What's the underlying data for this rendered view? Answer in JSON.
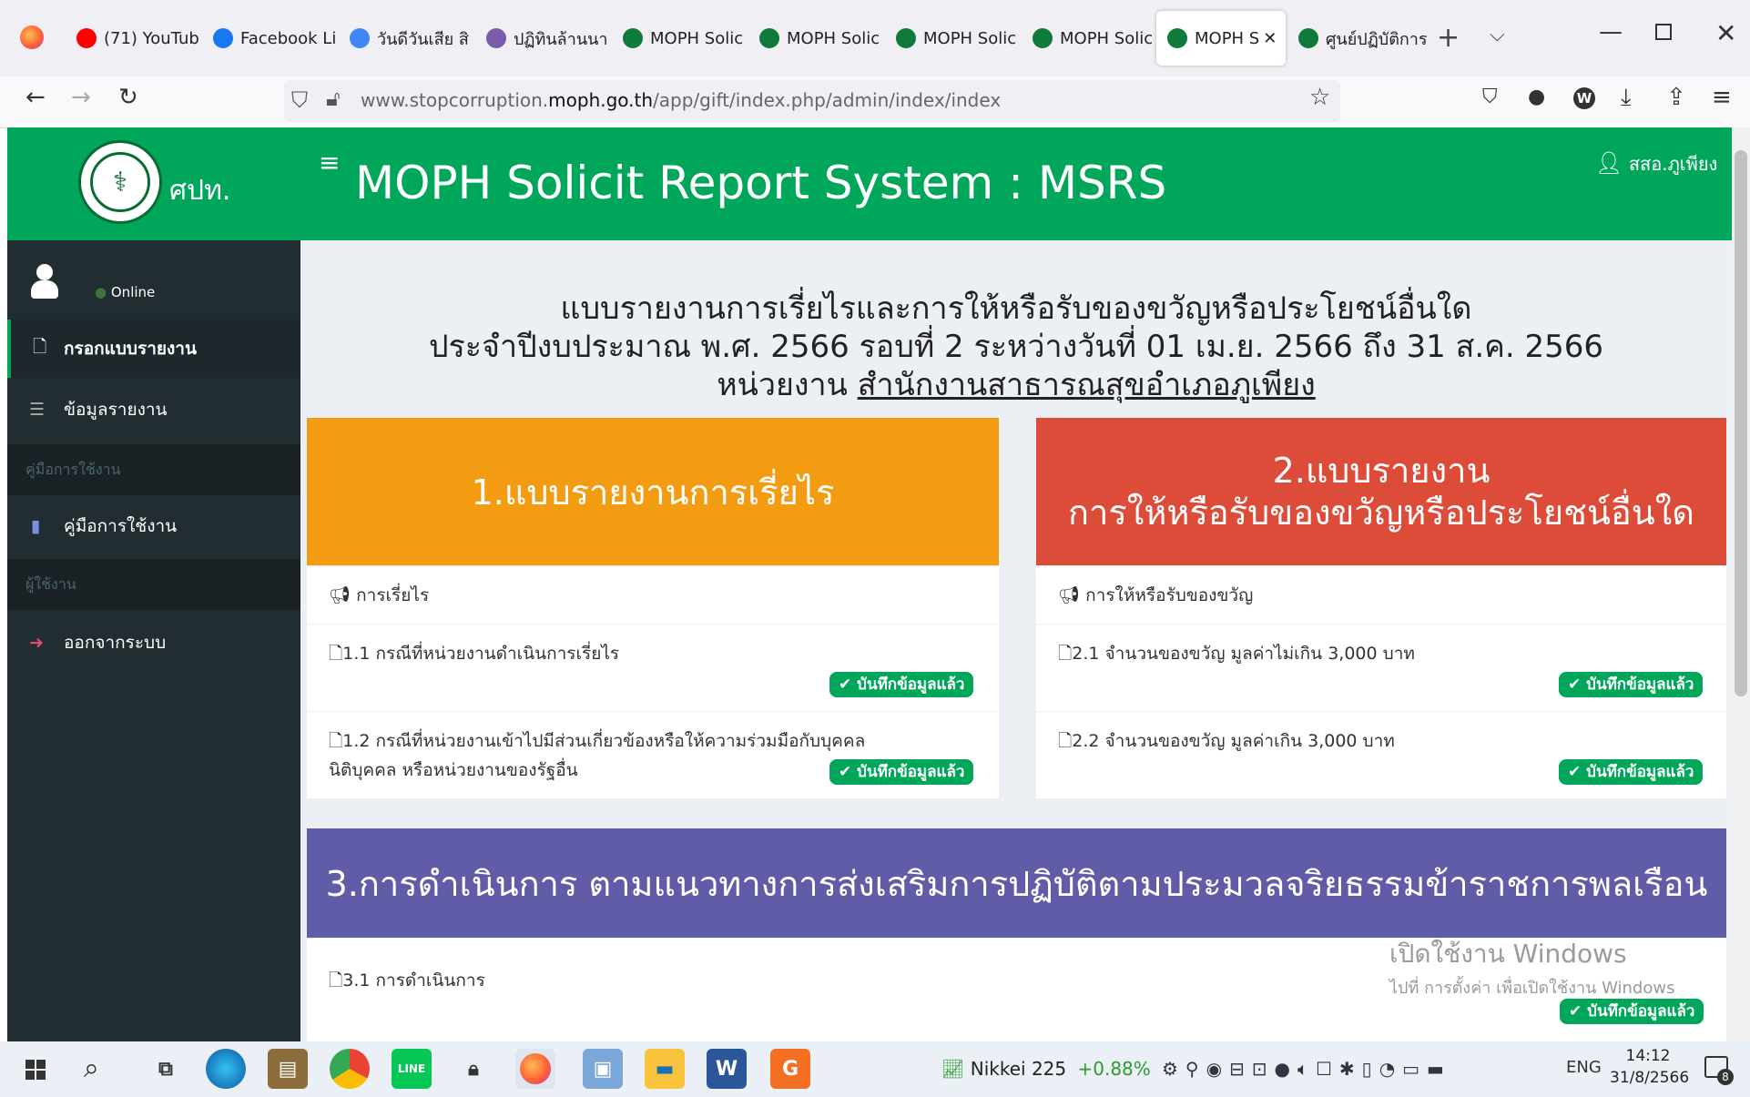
{
  "browser": {
    "tabs": [
      {
        "label": "(71) YouTub",
        "icon": "youtube-icon",
        "color": "#ff0000"
      },
      {
        "label": "Facebook Li",
        "icon": "facebook-icon",
        "color": "#1877f2"
      },
      {
        "label": "วันดีวันเสีย สิ",
        "icon": "google-icon",
        "color": "#4285f4"
      },
      {
        "label": "ปฏิทินล้านนา",
        "icon": "calendar-site-icon",
        "color": "#7a5ca8"
      },
      {
        "label": "MOPH Solic",
        "icon": "moph-icon",
        "color": "#0f7a3a"
      },
      {
        "label": "MOPH Solic",
        "icon": "moph-icon",
        "color": "#0f7a3a"
      },
      {
        "label": "MOPH Solic",
        "icon": "moph-icon",
        "color": "#0f7a3a"
      },
      {
        "label": "MOPH Solic",
        "icon": "moph-icon",
        "color": "#0f7a3a"
      },
      {
        "label": "MOPH S",
        "icon": "moph-icon",
        "color": "#0f7a3a",
        "active": true
      },
      {
        "label": "ศูนย์ปฏิบัติการ",
        "icon": "moph-icon",
        "color": "#0f7a3a"
      }
    ],
    "url_plain": "www.stopcorruption.",
    "url_domain": "moph.go.th",
    "url_path": "/app/gift/index.php/admin/index/index"
  },
  "app": {
    "brand": "ศปท.",
    "title": "MOPH Solicit Report System : MSRS",
    "user": "สสอ.ภูเพียง",
    "status": "Online"
  },
  "sidebar": {
    "items": [
      {
        "label": "กรอกแบบรายงาน",
        "icon": "document-icon"
      },
      {
        "label": "ข้อมูลรายงาน",
        "icon": "list-icon"
      }
    ],
    "header_manual": "คู่มือการใช้งาน",
    "manual_item": "คู่มือการใช้งาน",
    "header_user": "ผู้ใช้งาน",
    "logout": "ออกจากระบบ"
  },
  "report": {
    "title_line1": "แบบรายงานการเรี่ยไรและการให้หรือรับของขวัญหรือประโยชน์อื่นใด",
    "title_line2": "ประจำปีงบประมาณ พ.ศ. 2566 รอบที่ 2 ระหว่างวันที่ 01 เม.ย. 2566 ถึง 31 ส.ค. 2566",
    "unit_label": "หน่วยงาน",
    "unit_name": "สำนักงานสาธารณสุขอำเภอภูเพียง"
  },
  "box1": {
    "title": "1.แบบรายงานการเรี่ยไร",
    "section": "การเรี่ยไร",
    "row1": "1.1 กรณีที่หน่วยงานดำเนินการเรี่ยไร",
    "row2a": "1.2 กรณีที่หน่วยงานเข้าไปมีส่วนเกี่ยวข้องหรือให้ความร่วมมือกับบุคคล",
    "row2b": "นิติบุคคล หรือหน่วยงานของรัฐอื่น",
    "color": "#f39c12"
  },
  "box2": {
    "title_line1": "2.แบบรายงาน",
    "title_line2": "การให้หรือรับของขวัญหรือประโยชน์อื่นใด",
    "section": "การให้หรือรับของขวัญ",
    "row1": "2.1 จำนวนของขวัญ มูลค่าไม่เกิน 3,000 บาท",
    "row2": "2.2 จำนวนของขวัญ มูลค่าเกิน 3,000 บาท",
    "color": "#dd4b39"
  },
  "box3": {
    "title": "3.การดำเนินการ ตามแนวทางการส่งเสริมการปฏิบัติตามประมวลจริยธรรมข้าราชการพลเรือน",
    "row1": "3.1 การดำเนินการ",
    "color": "#605ca8"
  },
  "badge_saved": "✔ บันทึกข้อมูลแล้ว",
  "watermark": {
    "line1": "เปิดใช้งาน Windows",
    "line2": "ไปที่ การตั้งค่า เพื่อเปิดใช้งาน Windows"
  },
  "taskbar": {
    "ticker_name": "Nikkei 225",
    "ticker_change": "+0.88%",
    "lang": "ENG",
    "time": "14:12",
    "date": "31/8/2566",
    "notifications": "8"
  }
}
